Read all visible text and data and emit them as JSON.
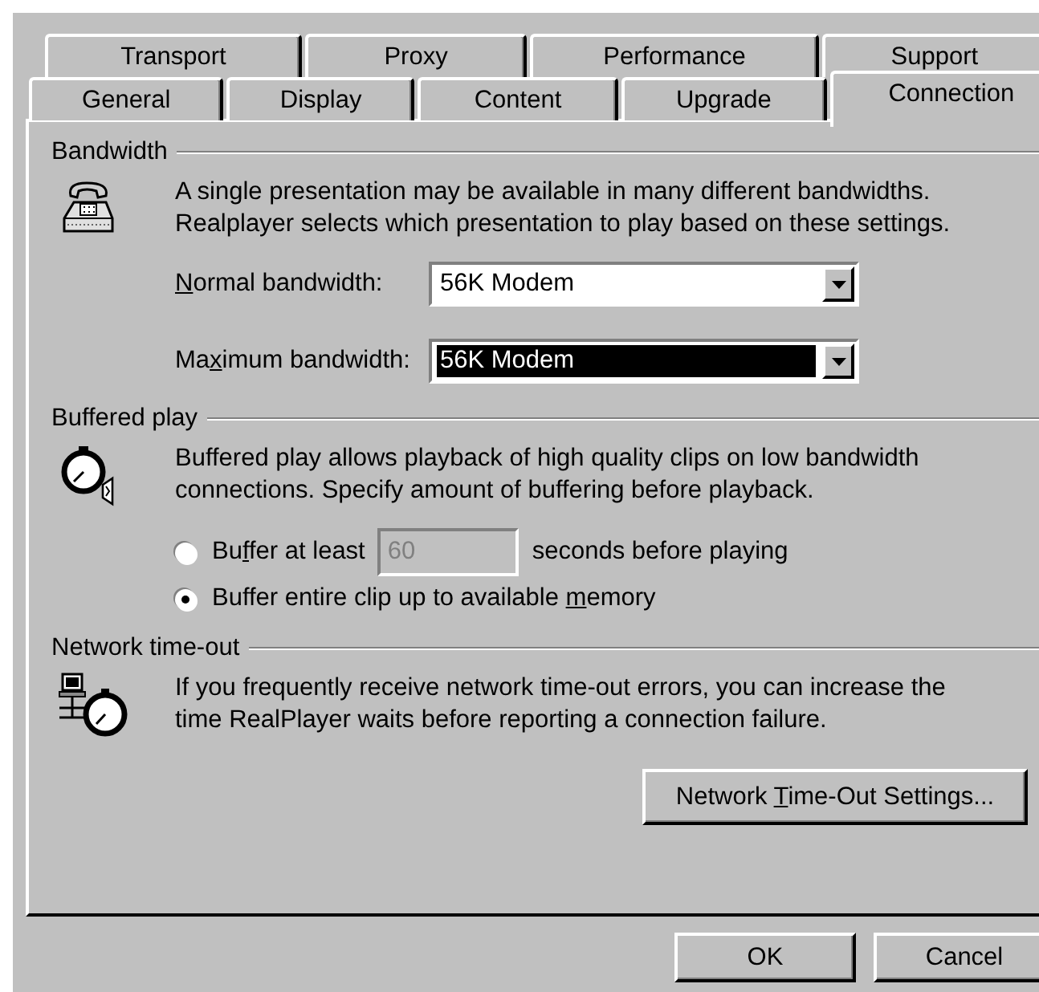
{
  "tab_rows": [
    {
      "tabs": [
        {
          "label": "Transport",
          "selected": false
        },
        {
          "label": "Proxy",
          "selected": false
        },
        {
          "label": "Performance",
          "selected": false
        },
        {
          "label": "Support",
          "selected": false
        }
      ]
    },
    {
      "tabs": [
        {
          "label": "General",
          "selected": false
        },
        {
          "label": "Display",
          "selected": false
        },
        {
          "label": "Content",
          "selected": false
        },
        {
          "label": "Upgrade",
          "selected": false
        },
        {
          "label": "Connection",
          "selected": true
        }
      ]
    }
  ],
  "bandwidth": {
    "title": "Bandwidth",
    "description": [
      "A single presentation may be available in many different bandwidths.",
      "Realplayer selects which presentation to play based on these settings."
    ],
    "fields": [
      {
        "access_key": "N",
        "label_end": "ormal bandwidth:",
        "value": "56K Modem",
        "focused": false
      },
      {
        "label_start": "Ma",
        "access_key": "x",
        "label_end": "imum bandwidth:",
        "value": "56K Modem",
        "focused": true
      }
    ]
  },
  "buffered_play": {
    "title": "Buffered play",
    "description": [
      "Buffered play allows playback of high quality clips on low bandwidth",
      "connections. Specify amount of buffering before playback."
    ],
    "options": [
      {
        "kind": "seconds",
        "label_start": "Bu",
        "access_key": "f",
        "label_end": "fer at least",
        "input": {
          "value": "60",
          "disabled": true
        },
        "suffix": "seconds before playing",
        "selected": false
      },
      {
        "kind": "plain",
        "label_start": "Buffer entire clip up to available ",
        "access_key": "m",
        "label_end": "emory",
        "selected": true
      }
    ]
  },
  "network_timeout": {
    "title": "Network time-out",
    "description": [
      "If you frequently receive network time-out errors, you can increase the",
      "time RealPlayer waits before reporting a connection failure."
    ],
    "button": {
      "label_start": "Network ",
      "access_key": "T",
      "label_end": "ime-Out Settings..."
    }
  },
  "buttons": [
    {
      "label": "OK"
    },
    {
      "label": "Cancel"
    }
  ]
}
